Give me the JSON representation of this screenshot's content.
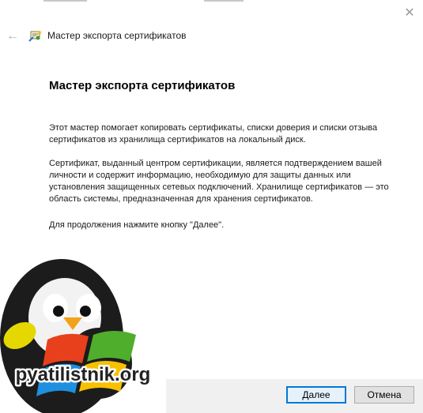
{
  "window": {
    "close_glyph": "✕",
    "back_glyph": "←"
  },
  "header": {
    "title": "Мастер экспорта сертификатов",
    "icon": "certificate-wizard-icon"
  },
  "content": {
    "heading": "Мастер экспорта сертификатов",
    "para1": "Этот мастер помогает копировать сертификаты, списки доверия и списки отзыва сертификатов из хранилища сертификатов на локальный диск.",
    "para2": "Сертификат, выданный центром сертификации, является подтверждением вашей личности и содержит информацию, необходимую для защиты данных или установления защищенных сетевых подключений. Хранилище сертификатов — это область системы, предназначенная для хранения сертификатов.",
    "para3": "Для продолжения нажмите кнопку \"Далее\"."
  },
  "buttons": {
    "next": "Далее",
    "cancel": "Отмена"
  },
  "watermark": {
    "text": "pyatilistnik.org",
    "icon": "penguin-windows-logo"
  },
  "colors": {
    "accent": "#0078d7",
    "footer_bg": "#f0f0f0"
  }
}
